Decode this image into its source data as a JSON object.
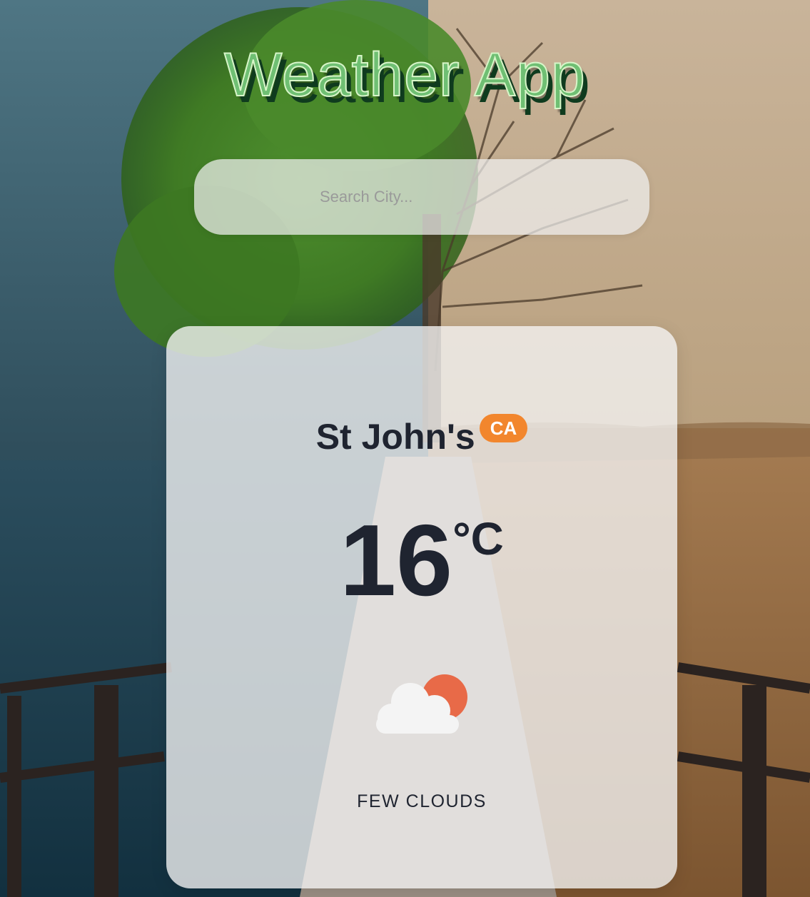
{
  "app": {
    "title": "Weather App"
  },
  "search": {
    "placeholder": "Search City...",
    "value": ""
  },
  "weather": {
    "city": "St John's",
    "country_code": "CA",
    "temperature": "16",
    "unit": "°C",
    "icon": "few-clouds-icon",
    "description": "FEW CLOUDS"
  },
  "colors": {
    "title_fill": "#6fbf73",
    "title_shadow": "#0f3b1e",
    "badge": "#f2862d",
    "sun": "#e86a48",
    "text": "#1f2430"
  }
}
